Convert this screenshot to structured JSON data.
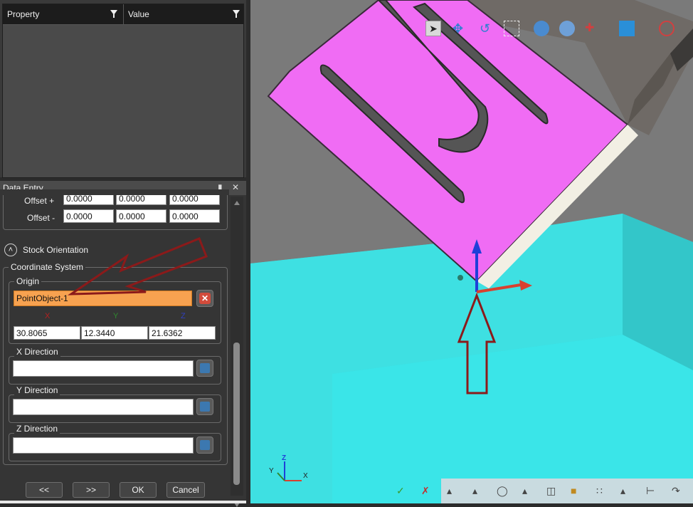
{
  "property_grid": {
    "col_property": "Property",
    "col_value": "Value"
  },
  "data_entry": {
    "title": "Data Entry",
    "pin_icon": "pin-icon",
    "close_icon": "close-icon",
    "offset_plus_label": "Offset +",
    "offset_minus_label": "Offset -",
    "offset_plus": [
      "0.0000",
      "0.0000",
      "0.0000"
    ],
    "offset_minus": [
      "0.0000",
      "0.0000",
      "0.0000"
    ],
    "stock_orientation_label": "Stock Orientation",
    "coordinate_system_label": "Coordinate System",
    "origin_label": "Origin",
    "origin_value": "PointObject-1",
    "axis_x": "X",
    "axis_y": "Y",
    "axis_z": "Z",
    "origin_x": "30.8065",
    "origin_y": "12.3440",
    "origin_z": "21.6362",
    "x_direction_label": "X Direction",
    "y_direction_label": "Y Direction",
    "z_direction_label": "Z Direction",
    "x_direction_value": "",
    "y_direction_value": "",
    "z_direction_value": "",
    "prev_button": "<<",
    "next_button": ">>",
    "ok_button": "OK",
    "cancel_button": "Cancel"
  },
  "viewport": {
    "triad_labels": [
      "X",
      "Y",
      "Z"
    ]
  },
  "colors": {
    "accent_origin_field": "#f7a250",
    "part_magenta": "#f06cf4",
    "stock_cyan": "#3ad9dc",
    "annotation_arrow": "#8b1a1a"
  }
}
